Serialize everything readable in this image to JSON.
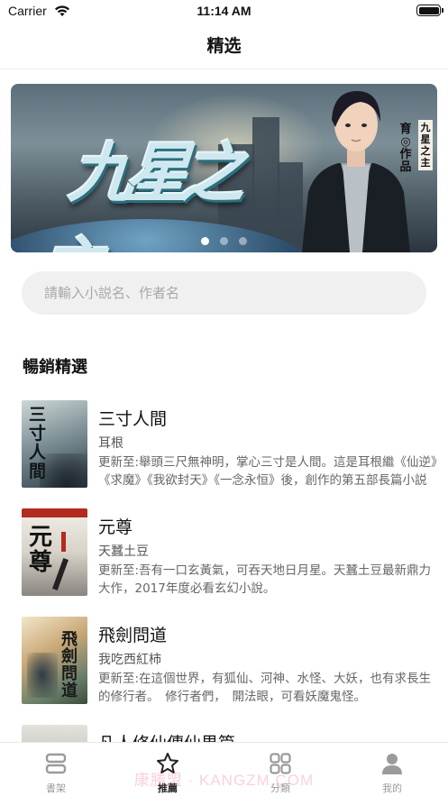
{
  "status_bar": {
    "carrier": "Carrier",
    "time": "11:14 AM"
  },
  "header": {
    "title": "精选"
  },
  "banner": {
    "vertical_title": "九星之主",
    "author_mark": "育◎作品",
    "pages": 3,
    "active_page": 1
  },
  "search": {
    "placeholder": "請輸入小説名、作者名",
    "value": ""
  },
  "section": {
    "title": "暢銷精選"
  },
  "books": [
    {
      "title": "三寸人間",
      "author": "耳根",
      "desc": "更新至:舉頭三尺無神明，掌心三寸是人間。這是耳根繼《仙逆》《求魔》《我欲封天》《一念永恒》後，創作的第五部長篇小説"
    },
    {
      "title": "元尊",
      "author": "天蠶土豆",
      "desc": "更新至:吾有一口玄黃氣，可吞天地日月星。天蠶土豆最新鼎力大作，2017年度必看玄幻小說。"
    },
    {
      "title": "飛劍問道",
      "author": "我吃西紅柿",
      "desc": "更新至:在這個世界，有狐仙、河神、水怪、大妖，也有求長生的修行者。　修行者們，　開法眼，可看妖魔鬼怪。"
    },
    {
      "title": "凡人修仙傳仙界篇",
      "author": "",
      "desc": ""
    }
  ],
  "tabs": [
    {
      "label": "書架",
      "icon": "bookshelf-icon",
      "active": false
    },
    {
      "label": "推薦",
      "icon": "star-icon",
      "active": true
    },
    {
      "label": "分類",
      "icon": "grid-icon",
      "active": false
    },
    {
      "label": "我的",
      "icon": "person-icon",
      "active": false
    }
  ],
  "watermark": "康勝盟 · KANGZM.COM",
  "colors": {
    "accent": "#222222",
    "inactive": "#999999",
    "search_bg": "#f0f0f0"
  }
}
